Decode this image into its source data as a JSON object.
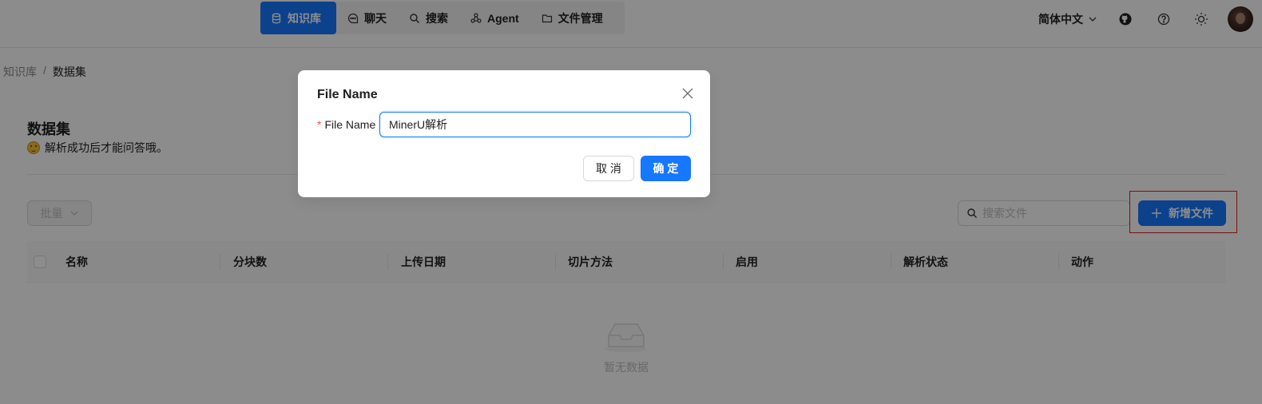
{
  "nav": {
    "items": [
      {
        "label": "知识库",
        "icon": "database-icon",
        "active": true
      },
      {
        "label": "聊天",
        "icon": "chat-icon"
      },
      {
        "label": "搜索",
        "icon": "search-icon"
      },
      {
        "label": "Agent",
        "icon": "agent-graph-icon"
      },
      {
        "label": "文件管理",
        "icon": "folder-icon"
      }
    ],
    "language": "简体中文",
    "accent_color": "#1677ff"
  },
  "breadcrumb": {
    "root": "知识库",
    "separator": "/",
    "current": "数据集"
  },
  "page": {
    "title": "数据集",
    "subtitle": "解析成功后才能问答哦。"
  },
  "toolbar": {
    "bulk_label": "批量",
    "search_placeholder": "搜索文件",
    "add_label": "新增文件"
  },
  "table": {
    "columns": [
      "名称",
      "分块数",
      "上传日期",
      "切片方法",
      "启用",
      "解析状态",
      "动作"
    ],
    "empty_text": "暂无数据"
  },
  "modal": {
    "title": "File Name",
    "field_label": "File Name",
    "field_value": "MinerU解析",
    "cancel_label": "取 消",
    "ok_label": "确 定"
  },
  "annotation": {
    "highlight_color": "#e02020"
  }
}
